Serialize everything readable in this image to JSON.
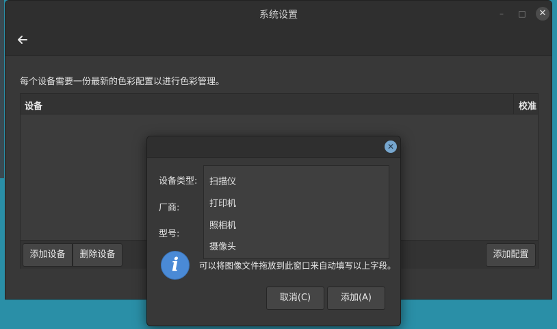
{
  "window": {
    "title": "系统设置",
    "minimize_glyph": "–",
    "maximize_glyph": "□",
    "close_glyph": "✕"
  },
  "main": {
    "description": "每个设备需要一份最新的色彩配置以进行色彩管理。",
    "columns": [
      "设备",
      "校准"
    ],
    "add_device_label": "添加设备",
    "remove_device_label": "删除设备",
    "add_profile_label": "添加配置"
  },
  "dialog": {
    "close_glyph": "✕",
    "device_type_label": "设备类型:",
    "vendor_label": "厂商:",
    "model_label": "型号:",
    "device_types": [
      "扫描仪",
      "打印机",
      "照相机",
      "摄像头"
    ],
    "info_glyph": "i",
    "hint": "可以将图像文件拖放到此窗口来自动填写以上字段。",
    "cancel_label": "取消(C)",
    "add_label": "添加(A)"
  },
  "colors": {
    "desktop": "#2a8fa7",
    "window_bg": "#383838",
    "accent_info": "#4a8ad6"
  },
  "icons": {
    "back": "arrow-left-icon",
    "info": "info-icon",
    "close": "close-icon"
  }
}
